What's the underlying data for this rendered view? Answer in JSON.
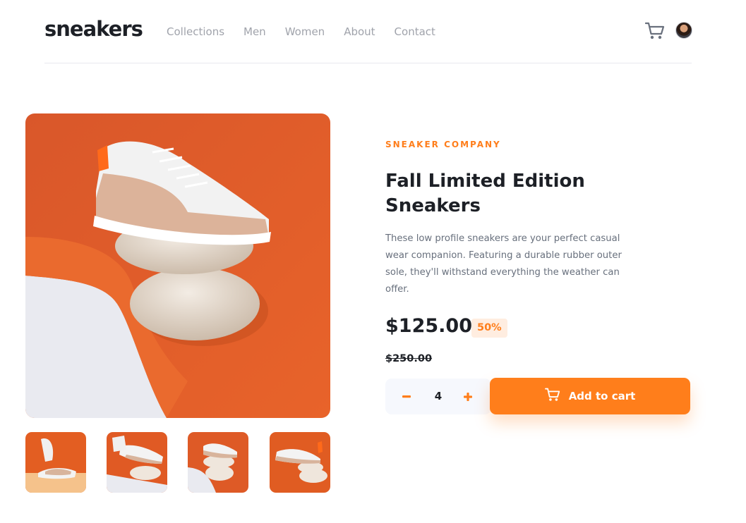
{
  "header": {
    "logo": "sneakers",
    "nav": [
      "Collections",
      "Men",
      "Women",
      "About",
      "Contact"
    ]
  },
  "product": {
    "company": "SNEAKER COMPANY",
    "title": "Fall Limited Edition Sneakers",
    "description": "These low profile sneakers are your perfect casual wear companion. Featuring a durable rubber outer sole, they'll withstand everything the weather can offer.",
    "price": "$125.00",
    "discount": "50%",
    "original_price": "$250.00"
  },
  "cart_controls": {
    "quantity": "4",
    "add_to_cart_label": "Add to cart"
  },
  "colors": {
    "accent": "#ff7e1b",
    "accent_pale": "#ffede0",
    "text_dark": "#1d2026",
    "text_grey": "#68707d",
    "nav_grey": "#a0a3ab"
  },
  "icons": [
    "cart-icon",
    "avatar",
    "minus-icon",
    "plus-icon"
  ]
}
